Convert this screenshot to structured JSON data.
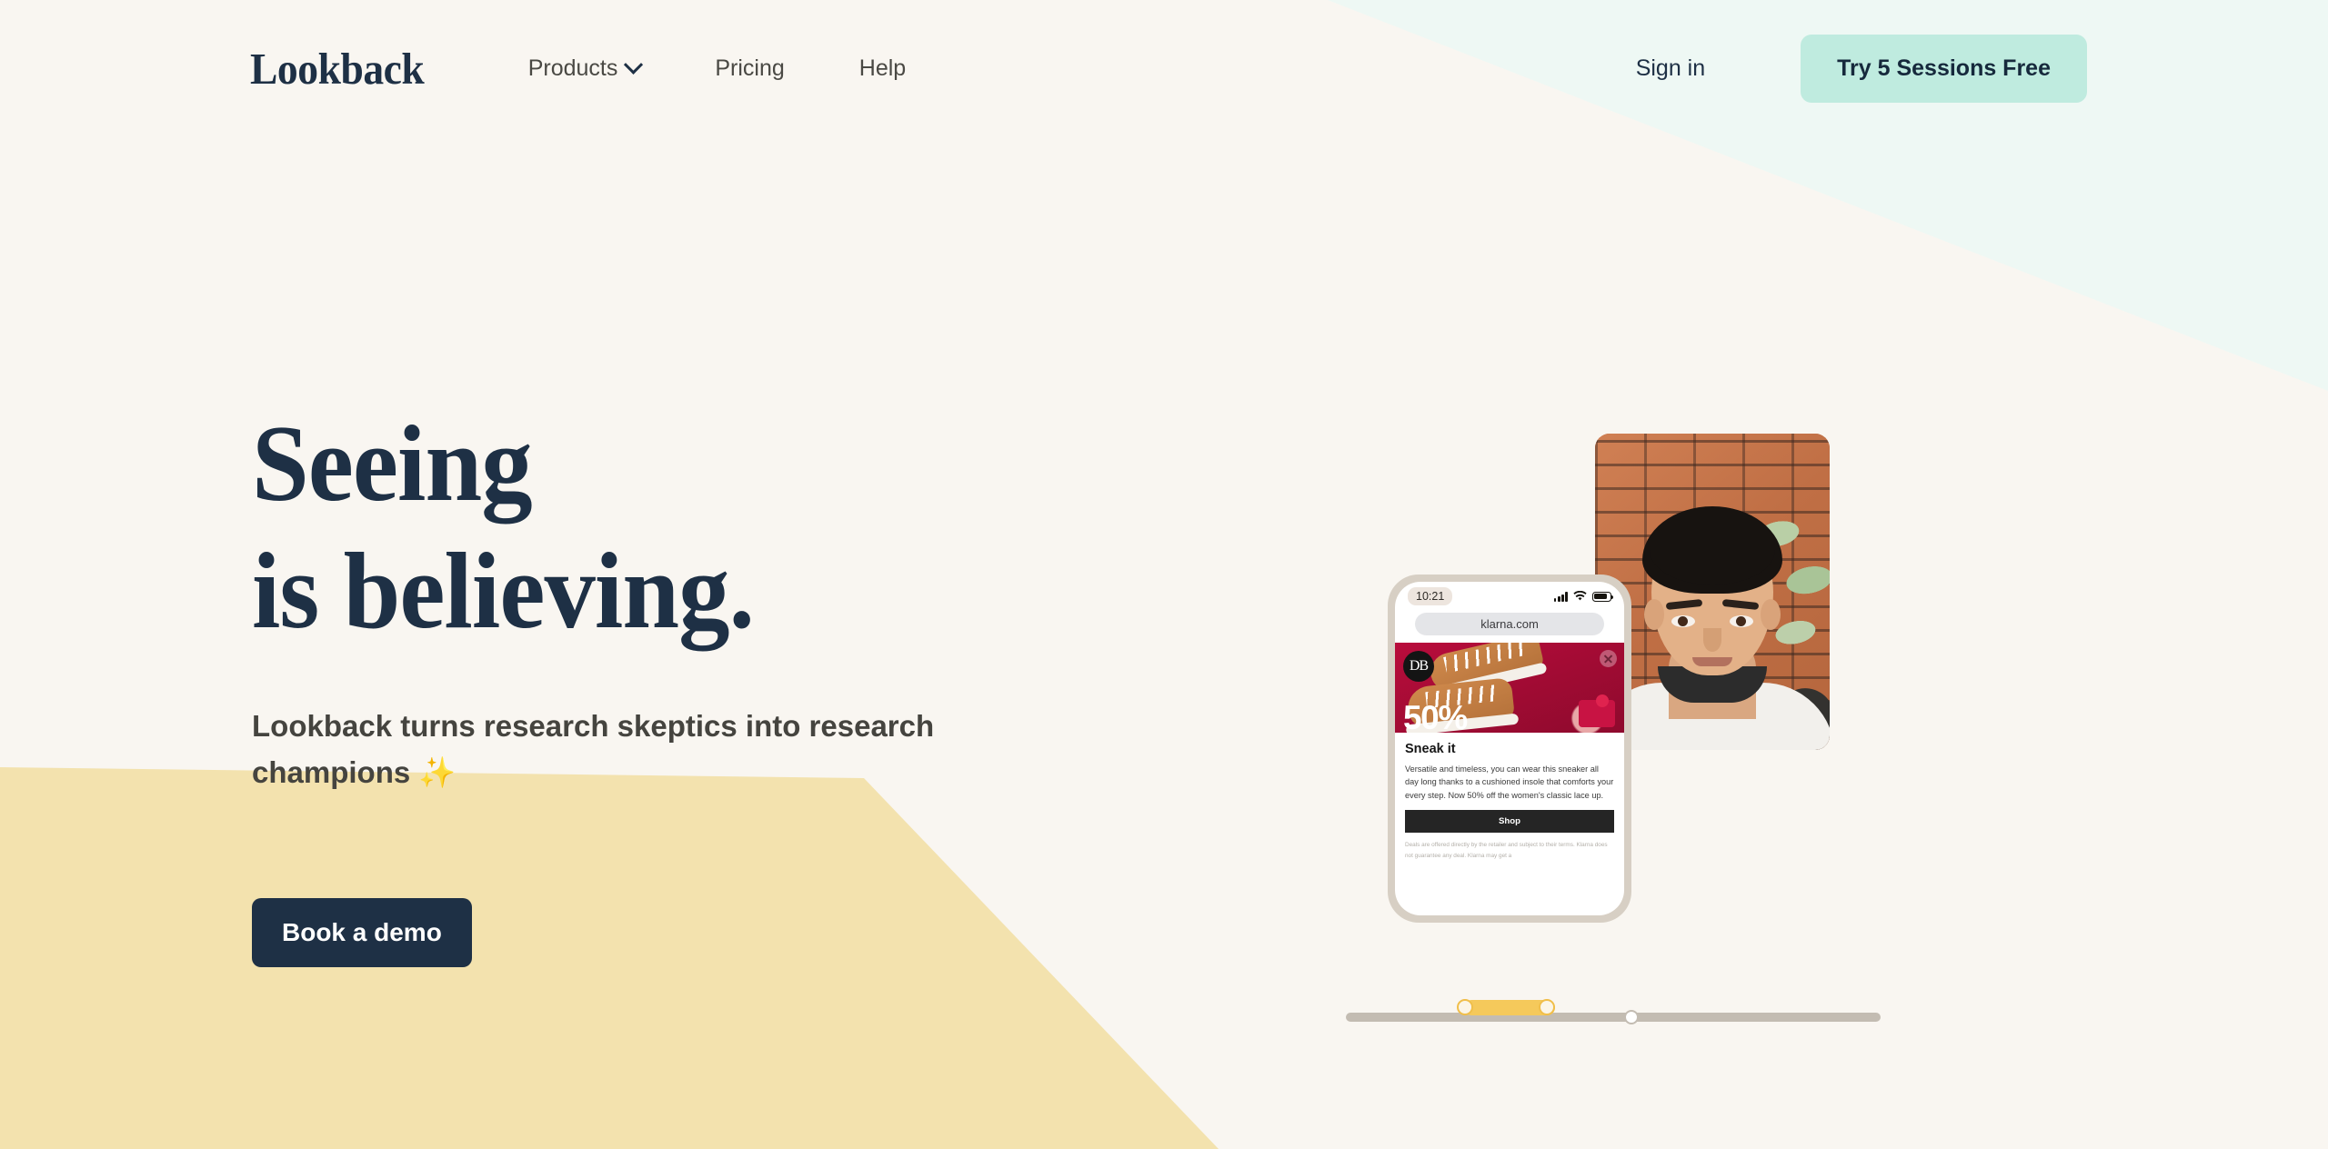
{
  "brand": {
    "logo_text": "Lookback"
  },
  "nav": {
    "items": [
      {
        "label": "Products",
        "has_dropdown": true,
        "icon": "chevron-down-icon"
      },
      {
        "label": "Pricing",
        "has_dropdown": false
      },
      {
        "label": "Help",
        "has_dropdown": false
      }
    ],
    "signin_label": "Sign in",
    "cta_label": "Try 5 Sessions Free"
  },
  "hero": {
    "title_line1": "Seeing",
    "title_line2": "is believing.",
    "subtitle": "Lookback turns research skeptics into research",
    "subtitle_line2": "champions",
    "sparkle": "✨",
    "demo_button": "Book a demo"
  },
  "phone": {
    "status": {
      "time": "10:21",
      "signal_icon": "signal-bars-icon",
      "wifi_icon": "wifi-icon",
      "battery_icon": "battery-icon"
    },
    "url": "klarna.com",
    "ad": {
      "brand_monogram": "DB",
      "discount": "50%",
      "close_icon": "close-icon",
      "title": "Sneak it",
      "description": "Versatile and timeless, you can wear this sneaker all day long thanks to a cushioned insole that comforts your every step. Now 50% off the women's classic lace up.",
      "shop_button": "Shop",
      "legal": "Deals are offered directly by the retailer and subject to their terms. Klarna does not guarantee any deal. Klarna may get a"
    }
  },
  "colors": {
    "page_background": "#F9F6F1",
    "mint_shape": "#EEF8F4",
    "yellow_shape": "#F3E2AE",
    "navy": "#1E3045",
    "cta_mint": "#BFEBDF",
    "accent_yellow": "#F5C95B"
  }
}
